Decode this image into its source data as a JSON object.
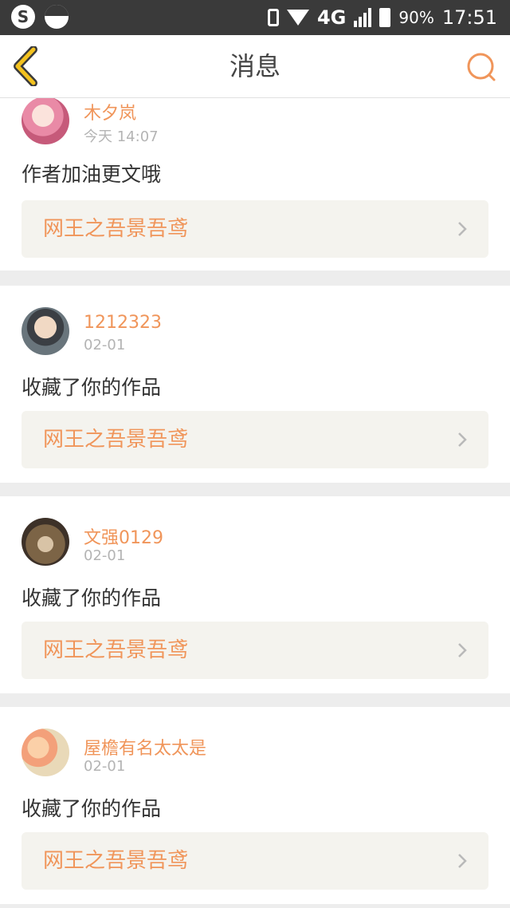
{
  "status_bar": {
    "network": "4G",
    "battery_percent": "90%",
    "time": "17:51",
    "icons": [
      "sogou-icon",
      "circle-icon",
      "vibrate-icon",
      "wifi-icon",
      "signal-icon",
      "battery-icon"
    ]
  },
  "header": {
    "title": "消息",
    "back_icon": "back-chevron-icon",
    "search_icon": "search-icon"
  },
  "colors": {
    "accent": "#f0955a",
    "back_icon": "#f3c21f",
    "card_bg": "#ffffff",
    "work_bg": "#f4f3ee",
    "separator": "#ededed"
  },
  "messages": [
    {
      "user": "木夕岚",
      "date": "今天 14:07",
      "text": "作者加油更文哦",
      "work": "网王之吾景吾鸢"
    },
    {
      "user": "1212323",
      "date": "02-01",
      "text": "收藏了你的作品",
      "work": "网王之吾景吾鸢"
    },
    {
      "user": "文强0129",
      "date": "02-01",
      "text": "收藏了你的作品",
      "work": "网王之吾景吾鸢"
    },
    {
      "user": "屋檐有名太太是",
      "date": "02-01",
      "text": "收藏了你的作品",
      "work": "网王之吾景吾鸢"
    }
  ]
}
